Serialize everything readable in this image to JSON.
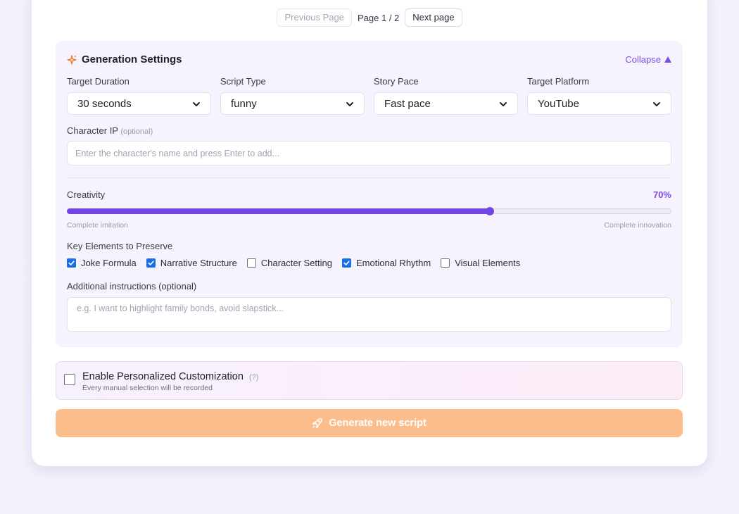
{
  "pagination": {
    "previous_label": "Previous Page",
    "page_info": "Page 1 / 2",
    "next_label": "Next page"
  },
  "settings": {
    "title": "Generation Settings",
    "collapse_label": "Collapse",
    "icons": {
      "header": "sparkle-icon",
      "collapse": "triangle-up-icon",
      "dropdown": "chevron-down-icon"
    },
    "fields": [
      {
        "label": "Target Duration",
        "value": "30 seconds"
      },
      {
        "label": "Script Type",
        "value": "funny"
      },
      {
        "label": "Story Pace",
        "value": "Fast pace"
      },
      {
        "label": "Target Platform",
        "value": "YouTube"
      }
    ],
    "character_ip": {
      "label": "Character IP",
      "optional": "(optional)",
      "placeholder": "Enter the character's name and press Enter to add..."
    },
    "creativity": {
      "label": "Creativity",
      "value_text": "70%",
      "value": 0.7,
      "min_label": "Complete imitation",
      "max_label": "Complete innovation"
    },
    "key_elements": {
      "label": "Key Elements to Preserve",
      "items": [
        {
          "label": "Joke Formula",
          "checked": true
        },
        {
          "label": "Narrative Structure",
          "checked": true
        },
        {
          "label": "Character Setting",
          "checked": false
        },
        {
          "label": "Emotional Rhythm",
          "checked": true
        },
        {
          "label": "Visual Elements",
          "checked": false
        }
      ]
    },
    "additional": {
      "label": "Additional instructions (optional)",
      "placeholder": "e.g. I want to highlight family bonds, avoid slapstick..."
    }
  },
  "personalization": {
    "title": "Enable Personalized Customization",
    "help": "(?)",
    "subtitle": "Every manual selection will be recorded",
    "checked": false
  },
  "generate": {
    "label": "Generate new script",
    "icon": "rocket-icon"
  },
  "colors": {
    "accent": "#7445e6",
    "checkbox": "#1a6ee8",
    "generate_button": "#fbbd8b"
  }
}
